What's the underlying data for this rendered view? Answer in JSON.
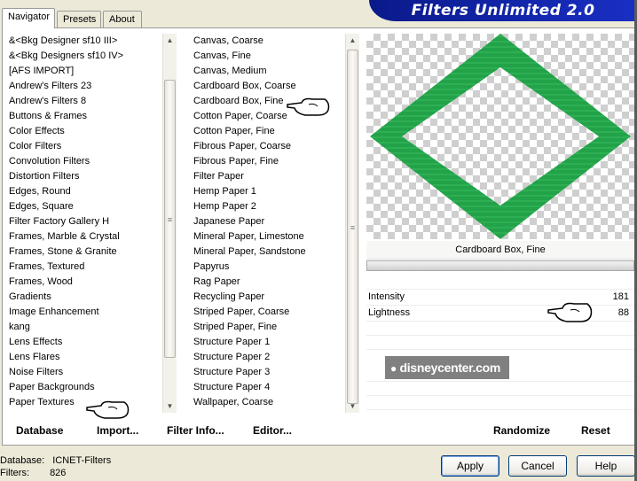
{
  "tabs": [
    {
      "label": "Navigator",
      "active": true
    },
    {
      "label": "Presets",
      "active": false
    },
    {
      "label": "About",
      "active": false
    }
  ],
  "banner": {
    "title": "Filters Unlimited 2.0"
  },
  "categories": [
    "&<Bkg Designer sf10 III>",
    "&<Bkg Designers sf10 IV>",
    "[AFS IMPORT]",
    "Andrew's Filters 23",
    "Andrew's Filters 8",
    "Buttons & Frames",
    "Color Effects",
    "Color Filters",
    "Convolution Filters",
    "Distortion Filters",
    "Edges, Round",
    "Edges, Square",
    "Filter Factory Gallery H",
    "Frames, Marble & Crystal",
    "Frames, Stone & Granite",
    "Frames, Textured",
    "Frames, Wood",
    "Gradients",
    "Image Enhancement",
    "kang",
    "Lens Effects",
    "Lens Flares",
    "Noise Filters",
    "Paper Backgrounds",
    "Paper Textures"
  ],
  "filters": [
    "Canvas, Coarse",
    "Canvas, Fine",
    "Canvas, Medium",
    "Cardboard Box, Coarse",
    "Cardboard Box, Fine",
    "Cotton Paper, Coarse",
    "Cotton Paper, Fine",
    "Fibrous Paper, Coarse",
    "Fibrous Paper, Fine",
    "Filter Paper",
    "Hemp Paper 1",
    "Hemp Paper 2",
    "Japanese Paper",
    "Mineral Paper, Limestone",
    "Mineral Paper, Sandstone",
    "Papyrus",
    "Rag Paper",
    "Recycling Paper",
    "Striped Paper, Coarse",
    "Striped Paper, Fine",
    "Structure Paper 1",
    "Structure Paper 2",
    "Structure Paper 3",
    "Structure Paper 4",
    "Wallpaper, Coarse"
  ],
  "preview": {
    "filter_name": "Cardboard Box, Fine",
    "shape_color": "#22a249"
  },
  "params": [
    {
      "name": "Intensity",
      "value": "181"
    },
    {
      "name": "Lightness",
      "value": "88"
    }
  ],
  "watermark": "disneycenter.com",
  "bottom_links": {
    "database": "Database",
    "import": "Import...",
    "filter_info": "Filter Info...",
    "editor": "Editor...",
    "randomize": "Randomize",
    "reset": "Reset"
  },
  "status": {
    "db_label": "Database:",
    "db_value": "ICNET-Filters",
    "filters_label": "Filters:",
    "filters_value": "826"
  },
  "buttons": {
    "apply": "Apply",
    "cancel": "Cancel",
    "help": "Help"
  }
}
